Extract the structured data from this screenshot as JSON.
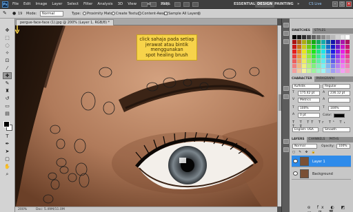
{
  "menubar": {
    "app_badge": "Ps",
    "items": [
      "File",
      "Edit",
      "Image",
      "Layer",
      "Select",
      "Filter",
      "Analysis",
      "3D",
      "View",
      "Window",
      "Help"
    ],
    "zoom": "200%"
  },
  "workspaces": {
    "items": [
      "ESSENTIALS",
      "DESIGN",
      "PAINTING"
    ],
    "overflow": "»",
    "cs_live": "CS Live"
  },
  "window_controls": [
    "–",
    "□",
    "×"
  ],
  "options": {
    "brush_size": "19",
    "mode_label": "Mode:",
    "mode_value": "Normal",
    "type_label": "Type:",
    "proximity": "Proximity Match",
    "texture": "Create Texture",
    "content_aware": "Content-Aware",
    "sample_all": "Sample All Layers"
  },
  "document": {
    "tab_title": "pergue-face-face (1).jpg @ 200% (Layer 1, RGB/8) *",
    "zoom_status": "200%",
    "doc_status": "Doc: 5.49M/11.0M"
  },
  "canvas": {
    "callout_line1": "click sahaja pada setiap",
    "callout_line2": "jerawat atau bintik",
    "callout_line3": "menggunakan",
    "callout_line4": "spot healing brush",
    "skin_color": "#b07a5a",
    "callout_color": "#f7d34a"
  },
  "panels": {
    "swatch_tabs": [
      "SWATCHES",
      "STYLES"
    ],
    "char_tabs": [
      "CHARACTER",
      "PARAGRAPH"
    ],
    "font_family": "Kufistik",
    "font_style": "Regular",
    "font_size": "175.42 pt",
    "leading": "236.12 pt",
    "tracking": "Metrics",
    "scale_v": "100%",
    "scale_h": "100%",
    "baseline": "0 pt",
    "color_label": "Color:",
    "language": "English: USA",
    "aa": "Smooth",
    "layer_tabs": [
      "LAYERS",
      "CHANNELS",
      "PATHS"
    ],
    "blend_mode": "Normal",
    "opacity_label": "Opacity:",
    "opacity": "100%",
    "layers": [
      {
        "name": "Layer 1",
        "selected": true
      },
      {
        "name": "Background",
        "selected": false
      }
    ]
  }
}
